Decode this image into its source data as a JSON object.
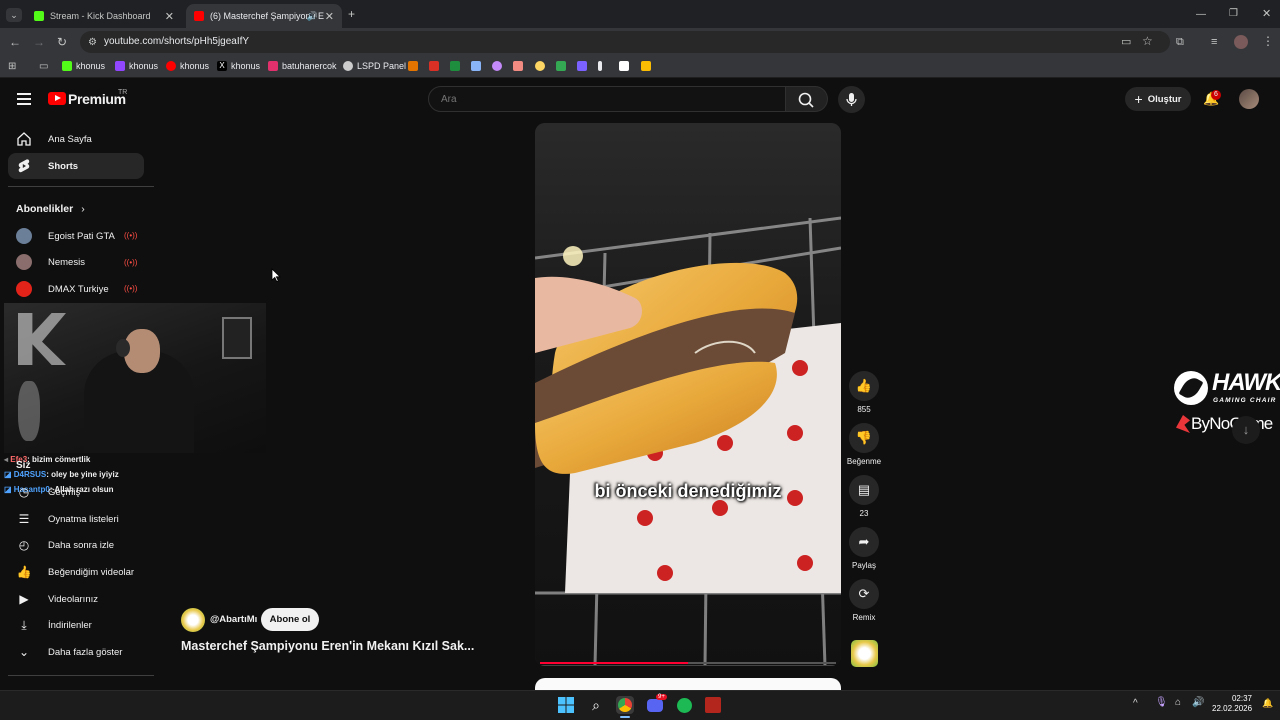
{
  "browser": {
    "tabs": [
      {
        "label": "Stream - Kick Dashboard",
        "favicon_color": "#53fc18"
      },
      {
        "label": "(6) Masterchef Şampiyonu E",
        "favicon_color": "#ff0000"
      }
    ],
    "url": "youtube.com/shorts/pHh5jgeaIfY",
    "bookmarks": [
      {
        "label": "khonus",
        "icon": "kick-icon",
        "color": "#53fc18"
      },
      {
        "label": "khonus",
        "icon": "twitch-icon",
        "color": "#9146ff"
      },
      {
        "label": "khonus",
        "icon": "youtube-icon",
        "color": "#ff0000"
      },
      {
        "label": "khonus",
        "icon": "x-icon",
        "color": "#e8eaed"
      },
      {
        "label": "batuhanercok",
        "icon": "instagram-icon",
        "color": "#e1306c"
      },
      {
        "label": "LSPD Panel",
        "icon": "lspd-icon",
        "color": "#cccccc"
      }
    ]
  },
  "youtube": {
    "logo": "Premium",
    "logo_country": "TR",
    "search_placeholder": "Ara",
    "create_label": "Oluştur",
    "notification_count": "6",
    "sidebar": {
      "items": [
        {
          "label": "Ana Sayfa",
          "icon": "home-icon"
        },
        {
          "label": "Shorts",
          "icon": "shorts-icon"
        }
      ],
      "subscriptions_title": "Abonelikler",
      "subscriptions": [
        {
          "label": "Egoist Pati GTA",
          "color": "#6b7f99"
        },
        {
          "label": "Nemesis",
          "color": "#8a6d6d"
        },
        {
          "label": "DMAX Turkiye",
          "color": "#e2231a"
        }
      ],
      "you_title": "Siz",
      "you_items": [
        {
          "label": "Geçmiş",
          "icon": "history-icon"
        },
        {
          "label": "Oynatma listeleri",
          "icon": "playlist-icon"
        },
        {
          "label": "Daha sonra izle",
          "icon": "clock-icon"
        },
        {
          "label": "Beğendiğim videolar",
          "icon": "like-icon"
        },
        {
          "label": "Videolarınız",
          "icon": "video-icon"
        },
        {
          "label": "İndirilenler",
          "icon": "download-icon"
        },
        {
          "label": "Daha fazla göster",
          "icon": "chevron-down-icon"
        }
      ]
    },
    "short": {
      "channel": "@AbartıMı",
      "subscribe_label": "Abone ol",
      "title": "Masterchef Şampiyonu Eren'in Mekanı Kızıl Sak...",
      "caption": "bi önceki denediğimiz",
      "likes": "855",
      "dislike_label": "Beğenme",
      "comments": "23",
      "share_label": "Paylaş",
      "remix_label": "Remix"
    }
  },
  "chat": [
    {
      "user": "Efe3",
      "message": ": bizim cömertlik",
      "color": "#ff6b6b"
    },
    {
      "user": "D4RSUS",
      "message": ": oley be yine iyiyiz",
      "color": "#4fa3ff"
    },
    {
      "user": "Hasantp0",
      "message": ": Allah razı olsun",
      "color": "#4fa3ff"
    }
  ],
  "overlay": {
    "brand1": "HAWK",
    "brand1_sub": "GAMING CHAIR",
    "brand2": "ByNoGame"
  },
  "taskbar": {
    "time": "02:37",
    "date": "22.02.2026",
    "discord_badge": "9+"
  }
}
